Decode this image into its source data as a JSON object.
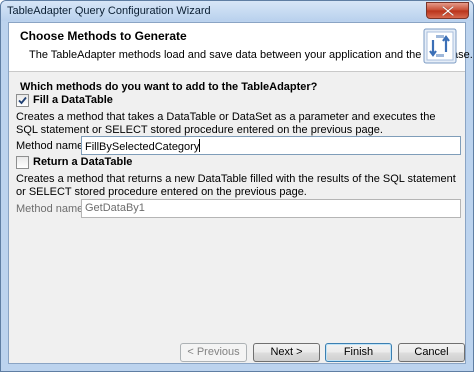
{
  "window": {
    "title": "TableAdapter Query Configuration Wizard"
  },
  "header": {
    "title": "Choose Methods to Generate",
    "description": "The TableAdapter methods load and save data between your application and the database.",
    "icon": "wizard-header-icon"
  },
  "question": "Which methods do you want to add to the TableAdapter?",
  "fill_option": {
    "label": "Fill a DataTable",
    "checked": true,
    "description": "Creates a method that takes a DataTable or DataSet as a parameter and executes the SQL statement or SELECT stored procedure entered on the previous page.",
    "method_label": "Method name:",
    "method_value": "FillBySelectedCategory"
  },
  "return_option": {
    "label": "Return a DataTable",
    "checked": false,
    "description": "Creates a method that returns a new DataTable filled with the results of the SQL statement or SELECT stored procedure entered on the previous page.",
    "method_label": "Method name:",
    "method_value": "GetDataBy1"
  },
  "buttons": {
    "previous": "< Previous",
    "next": "Next >",
    "finish": "Finish",
    "cancel": "Cancel"
  }
}
